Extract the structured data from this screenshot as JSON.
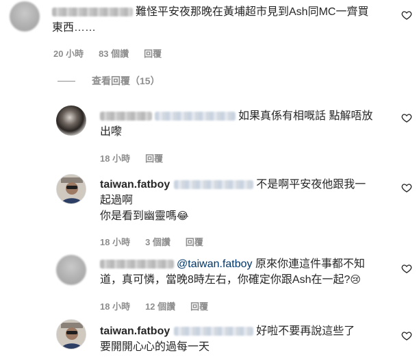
{
  "comments": [
    {
      "id": "c1",
      "avatar": "blurred-avatar",
      "username_hidden": true,
      "text_line1": "難怪平安夜那晚在黃埔超市見到Ash同MC一齊買",
      "text_line2": "東西……",
      "time": "20 小時",
      "likes": "83 個讚",
      "reply": "回覆"
    },
    {
      "id": "c2",
      "avatar": "blurred-dark-avatar",
      "username_hidden": true,
      "text_line1": "如果真係有相嘅話 點解唔放",
      "text_line2": "出嚟",
      "time": "18 小時",
      "reply": "回覆"
    },
    {
      "id": "c3",
      "avatar": "profile-photo",
      "username": "taiwan.fatboy",
      "text_line1": "不是啊平安夜他跟我一",
      "text_line2": "起過啊",
      "text_line3": "你是看到幽靈嗎",
      "emoji": "😂",
      "time": "18 小時",
      "likes": "3 個讚",
      "reply": "回覆"
    },
    {
      "id": "c4",
      "avatar": "blurred-avatar",
      "username_hidden": true,
      "mention": "@taiwan.fatboy",
      "text_line1": "原來你連這件事都不知",
      "text_line2": "道，真可憐，當晚8時左右，你確定你跟Ash在一起?",
      "emoji": "😢",
      "time": "18 小時",
      "likes": "12 個讚",
      "reply": "回覆"
    },
    {
      "id": "c5",
      "avatar": "profile-photo",
      "username": "taiwan.fatboy",
      "text_line1": "好啦不要再說這些了",
      "text_line2": "要開開心心的過每一天"
    }
  ],
  "view_replies": "查看回覆（15）",
  "icons": {
    "like": "heart-outline-icon"
  },
  "colors": {
    "text": "#262626",
    "meta": "#8e8e8e",
    "mention": "#00376b"
  }
}
